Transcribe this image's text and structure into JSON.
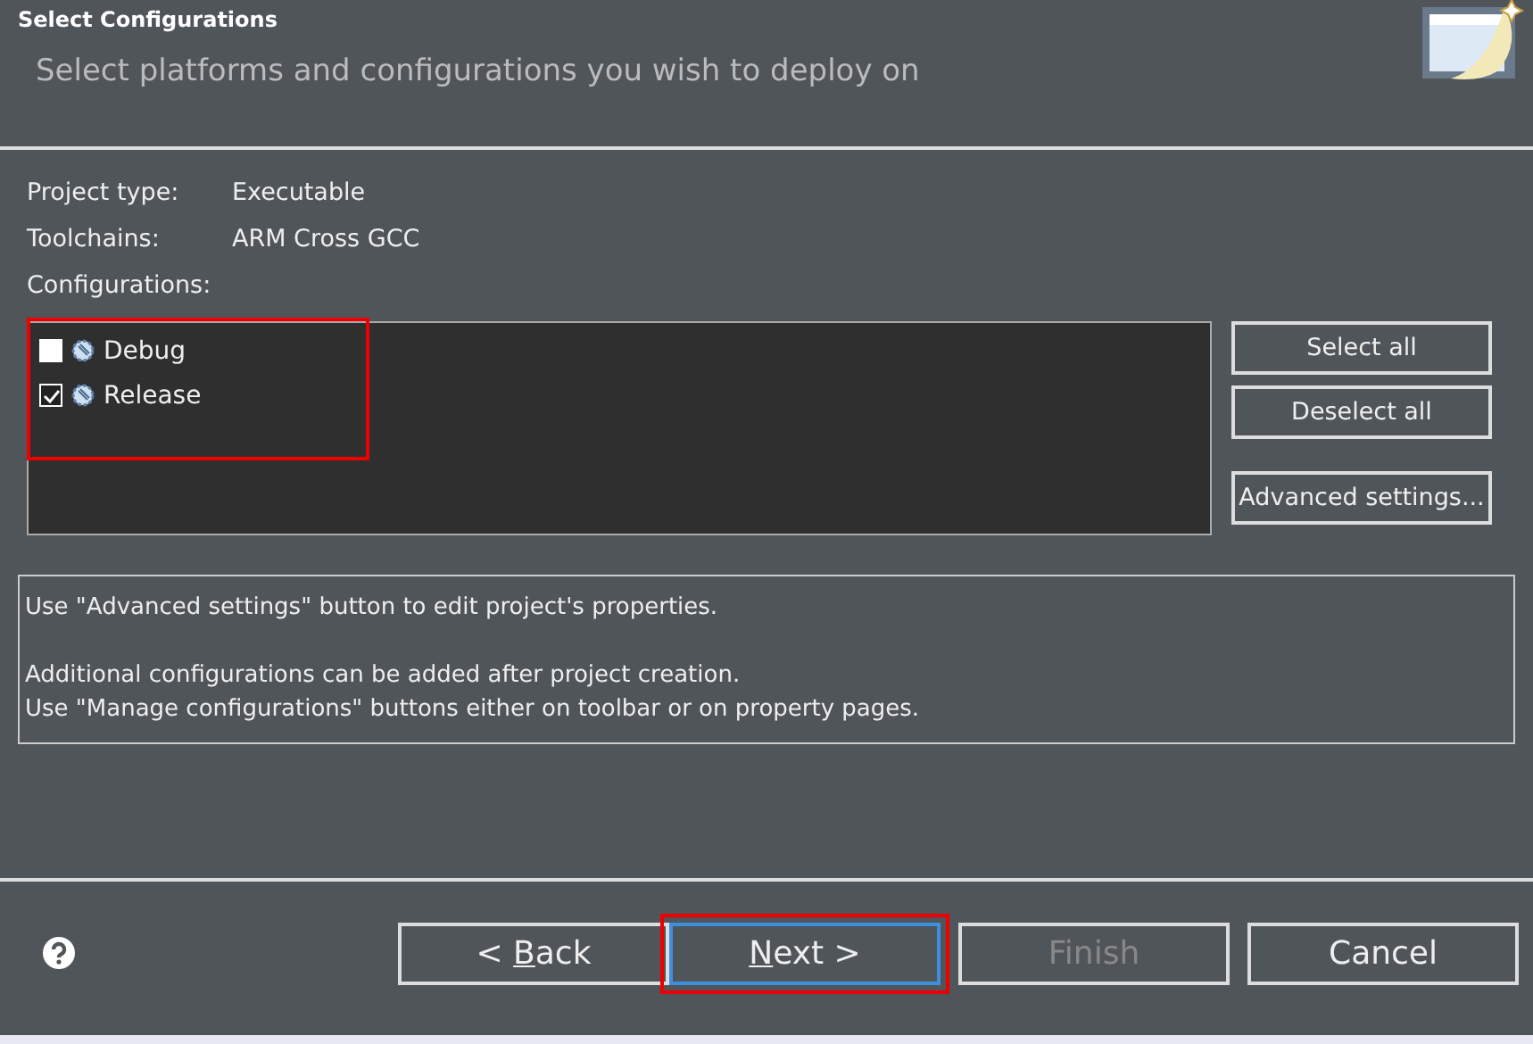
{
  "header": {
    "title": "Select Configurations",
    "subtitle": "Select platforms and configurations you wish to deploy on"
  },
  "properties": [
    {
      "label": "Project type:",
      "value": "Executable"
    },
    {
      "label": "Toolchains:",
      "value": "ARM Cross GCC"
    }
  ],
  "configurations": {
    "label": "Configurations:",
    "highlighted": true,
    "items": [
      {
        "name": "Debug",
        "checked": false
      },
      {
        "name": "Release",
        "checked": true
      }
    ]
  },
  "side_buttons": [
    "Select all",
    "Deselect all",
    "Advanced settings..."
  ],
  "info": [
    [
      "Use \"Advanced settings\" button to edit project's properties."
    ],
    [
      "Additional configurations can be added after project creation.",
      "Use \"Manage configurations\" buttons either on toolbar or on property pages."
    ]
  ],
  "footer_buttons": [
    {
      "pre": "< ",
      "key": "B",
      "post": "ack",
      "disabled": false,
      "focused": false,
      "highlighted": false
    },
    {
      "key": "N",
      "post": "ext >",
      "disabled": false,
      "focused": true,
      "highlighted": true
    },
    {
      "pre": "Finish",
      "disabled": true,
      "focused": false,
      "highlighted": false
    },
    {
      "pre": "Cancel",
      "disabled": false,
      "focused": false,
      "highlighted": false
    }
  ]
}
